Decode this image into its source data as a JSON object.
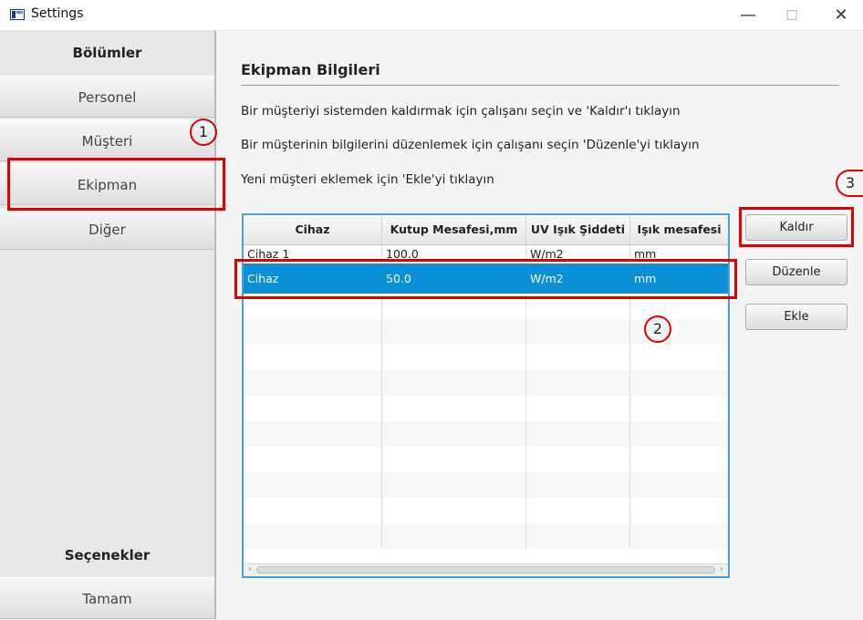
{
  "window": {
    "title": "Settings",
    "minimize_glyph": "—",
    "maximize_glyph": "☐",
    "close_glyph": "✕",
    "icon": "app-window-icon"
  },
  "sidebar": {
    "header": "Bölümler",
    "items": [
      {
        "label": "Personel"
      },
      {
        "label": "Müşteri"
      },
      {
        "label": "Ekipman"
      },
      {
        "label": "Diğer"
      }
    ],
    "footer_header": "Seçenekler",
    "footer_button": "Tamam"
  },
  "main": {
    "title": "Ekipman Bilgileri",
    "instructions": [
      "Bir müşteriyi sistemden kaldırmak için çalışanı seçin ve 'Kaldır'ı tıklayın",
      "Bir müşterinin bilgilerini düzenlemek için çalışanı seçin 'Düzenle'yi tıklayın",
      "Yeni müşteri eklemek için 'Ekle'yi tıklayın"
    ]
  },
  "table": {
    "columns": [
      "Cihaz",
      "Kutup Mesafesi,mm",
      "UV Işık Şiddeti",
      "Işık mesafesi"
    ],
    "rows": [
      [
        "Cihaz 1",
        "100.0",
        "W/m2",
        "mm"
      ],
      [
        "Cihaz",
        "50.0",
        "W/m2",
        "mm"
      ]
    ],
    "selected_row_index": 1,
    "scroll_left_glyph": "‹",
    "scroll_right_glyph": "›"
  },
  "actions": {
    "remove": "Kaldır",
    "edit": "Düzenle",
    "add": "Ekle"
  },
  "annotations": {
    "callout_1": "1",
    "callout_2": "2",
    "callout_3": "3",
    "highlight_color": "#e10000"
  },
  "colors": {
    "selection": "#0b8fd6",
    "table_border": "#4a9fdf"
  }
}
